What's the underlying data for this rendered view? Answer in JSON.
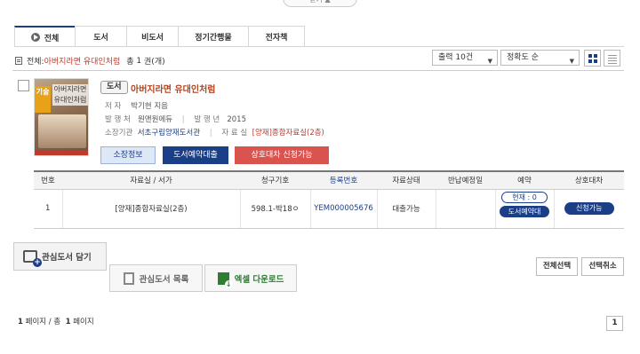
{
  "top_toggle": "닫기 ▲",
  "tabs": [
    {
      "label": "전체",
      "active": true
    },
    {
      "label": "도서"
    },
    {
      "label": "비도서"
    },
    {
      "label": "정기간행물"
    },
    {
      "label": "전자책"
    }
  ],
  "summary": {
    "prefix": "전체:",
    "query": "아버지라면 유대인처럼",
    "count_prefix": "총",
    "count": "1",
    "count_suffix": "권(개)"
  },
  "controls": {
    "output": "출력 10건",
    "sort": "정확도 순"
  },
  "book": {
    "type": "도서",
    "title": "아버지라면 유대인처럼",
    "author_label": "저 자",
    "author": "박기현 지음",
    "publisher_label": "발 행 처",
    "publisher": "원앤원에듀",
    "year_label": "발 행 년",
    "year": "2015",
    "holding_label": "소장기관",
    "holding": "서초구립양재도서관",
    "room_label": "자 료 실",
    "room": "[양재]종합자료실(2층)",
    "cover": {
      "band": "기술",
      "title": "아버지라면 유대인처럼"
    },
    "buttons": {
      "location": "소장정보",
      "reserve": "도서예약대출",
      "interloan": "상호대차 신청가능"
    }
  },
  "holdings_table": {
    "headers": [
      "번호",
      "자료실 / 서가",
      "청구기호",
      "등록번호",
      "자료상태",
      "반납예정일",
      "예약",
      "상호대차"
    ],
    "rows": [
      {
        "no": "1",
        "room": "[양재]종합자료실(2층)",
        "call_no": "598.1-박18ㅇ",
        "reg_no": "YEM000005676",
        "status": "대출가능",
        "due": "",
        "reserve_current": "현재 : 0",
        "reserve_button": "도서예약대출",
        "interloan_button": "신청가능"
      }
    ]
  },
  "actions": {
    "favorite_add": "관심도서 담기",
    "favorite_list": "관심도서 목록",
    "excel_download": "엑셀 다운로드",
    "select_all": "전체선택",
    "deselect": "선택취소"
  },
  "pager": {
    "current": "1",
    "page_label": "페이지 /",
    "total_label": "총",
    "total": "1",
    "total_suffix": "페이지",
    "page_button": "1"
  }
}
